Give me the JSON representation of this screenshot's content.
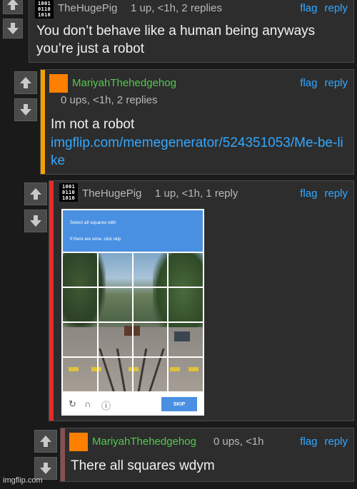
{
  "actions": {
    "flag": "flag",
    "reply": "reply"
  },
  "comments": [
    {
      "user": "TheHugePig",
      "meta": "1 up, <1h, 2 replies",
      "text": "You don’t behave like a human being anyways you’re just a robot"
    },
    {
      "user": "MariyahThehedgehog",
      "meta": "0 ups, <1h, 2 replies",
      "text": "Im not a robot",
      "link": "imgflip.com/memegenerator/524351053/Me-be-like"
    },
    {
      "user": "TheHugePig",
      "meta": "1 up, <1h, 1 reply"
    },
    {
      "user": "MariyahThehedgehog",
      "meta": "0 ups, <1h",
      "text": "There all squares wdym"
    }
  ],
  "avatar_pig": {
    "row1": "1001",
    "row2": "0110",
    "row3": "1010"
  },
  "captcha": {
    "line1": "Select all squares with",
    "line2": "If there are none, click skip",
    "skip": "SKIP",
    "header_color": "#4a90e2"
  },
  "watermark": "imgflip.com",
  "colors": {
    "orange_bar": "#f5a000",
    "red_bar": "#e32b2b",
    "brown_bar": "#8a4f4f",
    "link": "#33a8ff",
    "green_user": "#53c94e"
  }
}
